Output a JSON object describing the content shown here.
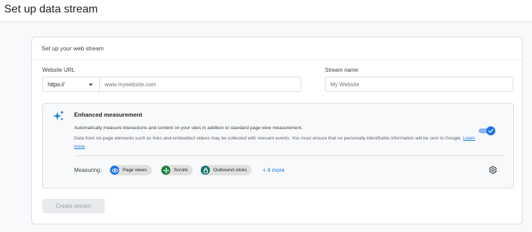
{
  "page": {
    "title": "Set up data stream"
  },
  "card": {
    "title": "Set up your web stream"
  },
  "form": {
    "website_url_label": "Website URL",
    "protocol_value": "https://",
    "url_placeholder": "www.mywebsite.com",
    "stream_name_label": "Stream name",
    "stream_name_placeholder": "My Website"
  },
  "enhanced": {
    "title": "Enhanced measurement",
    "description": "Automatically measure interactions and content on your sites in addition to standard page view measurement.",
    "note": "Data from on-page elements such as links and embedded videos may be collected with relevant events. You must ensure that no personally-identifiable information will be sent to Google.",
    "learn_more": "Learn more",
    "enabled": true,
    "measuring_label": "Measuring:",
    "chips": [
      {
        "label": "Page views",
        "icon": "eye-icon",
        "color": "#1a73e8"
      },
      {
        "label": "Scrolls",
        "icon": "crosshair-icon",
        "color": "#188038"
      },
      {
        "label": "Outbound clicks",
        "icon": "lock-icon",
        "color": "#12736b"
      }
    ],
    "more_link": "+ 4 more"
  },
  "create_button": "Create stream",
  "colors": {
    "accent": "#1a73e8",
    "sparkle": "#1a73e8"
  }
}
